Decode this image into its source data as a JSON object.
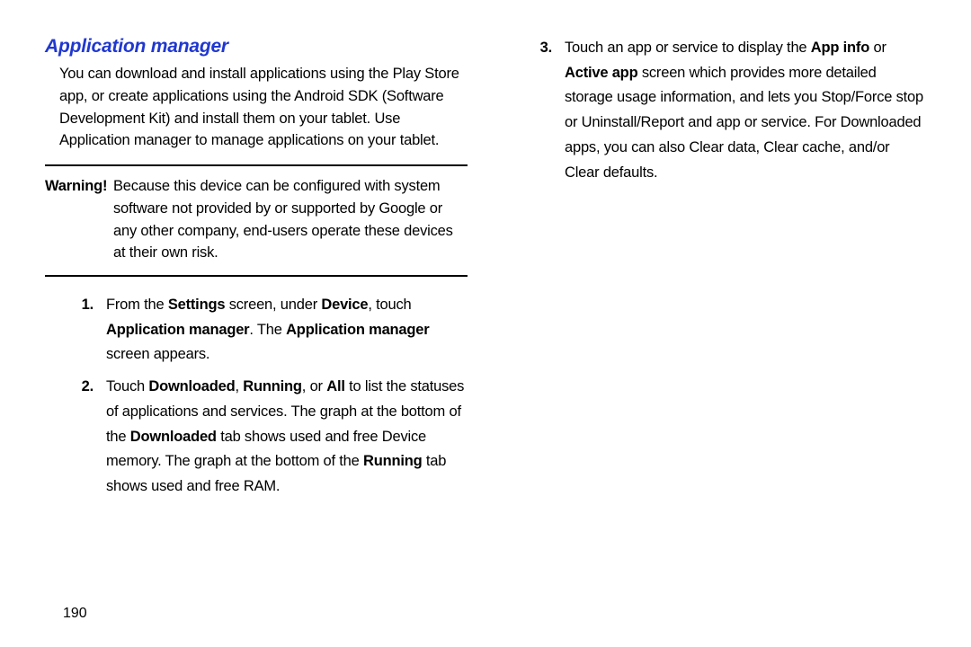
{
  "heading": "Application manager",
  "intro": "You can download and install applications using the Play Store app, or create applications using the Android SDK (Software Development Kit) and install them on your tablet. Use Application manager to manage applications on your tablet.",
  "warning": {
    "label": "Warning!",
    "text": "Because this device can be configured with system software not provided by or supported by Google or any other company, end-users operate these devices at their own risk."
  },
  "step1": {
    "num": "1.",
    "t0": "From the ",
    "b0": "Settings",
    "t1": " screen, under ",
    "b1": "Device",
    "t2": ", touch ",
    "b2": "Application manager",
    "t3": ". The ",
    "b3": "Application manager",
    "t4": " screen appears."
  },
  "step2": {
    "num": "2.",
    "t0": "Touch ",
    "b0": "Downloaded",
    "t1": ", ",
    "b1": "Running",
    "t2": ", or ",
    "b2": "All",
    "t3": " to list the statuses of applications and services. The graph at the bottom of the ",
    "b3": "Downloaded",
    "t4": " tab shows used and free Device memory. The graph at the bottom of the ",
    "b4": "Running",
    "t5": " tab shows used and free RAM."
  },
  "step3": {
    "num": "3.",
    "t0": "Touch an app or service to display the ",
    "b0": "App info",
    "t1": " or ",
    "b1": "Active app",
    "t2": " screen which provides more detailed storage usage information, and lets you Stop/Force stop or Uninstall/Report and app or service. For Downloaded apps, you can also Clear data, Clear cache, and/or Clear defaults."
  },
  "pageNumber": "190"
}
